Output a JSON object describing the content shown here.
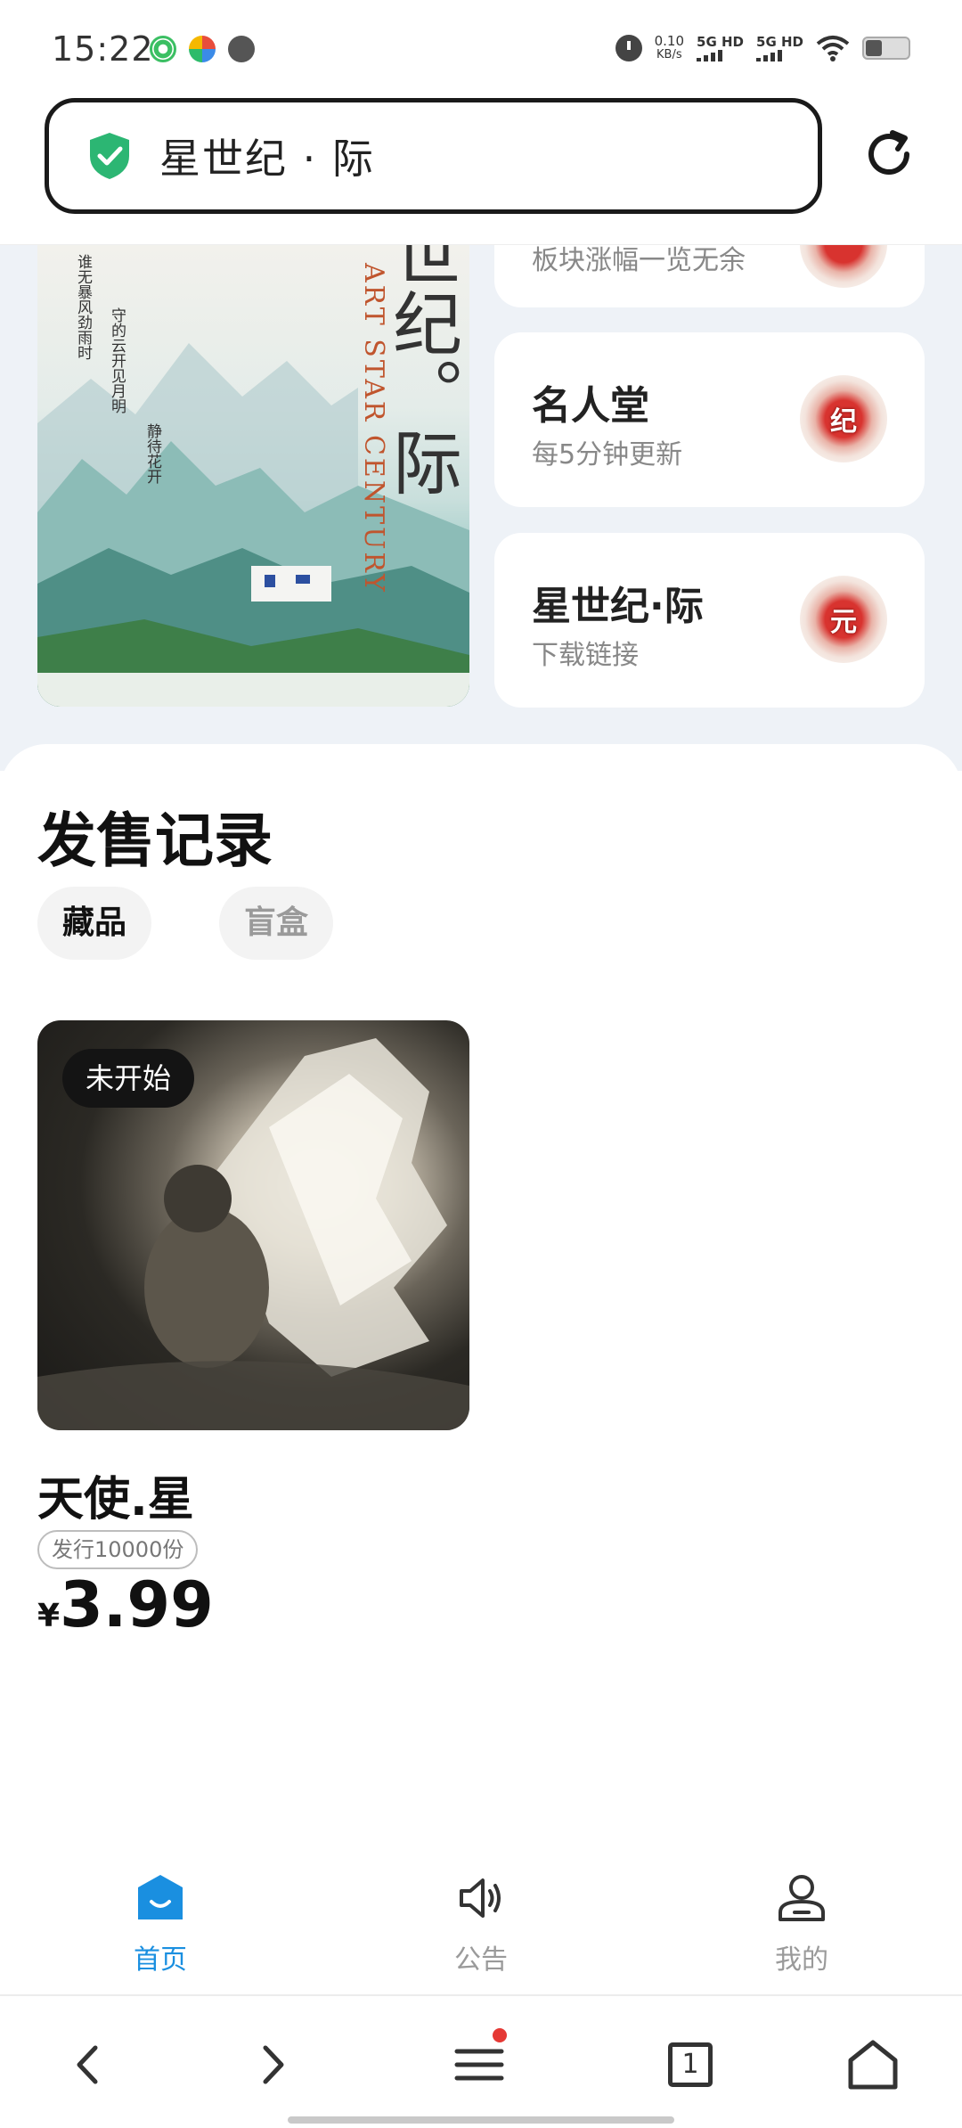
{
  "status_bar": {
    "time": "15:22",
    "net_speed_value": "0.10",
    "net_speed_unit": "KB/s",
    "sim1": "5G HD",
    "sim2": "5G HD",
    "icons": [
      "app-icon-green",
      "app-icon-colorful",
      "alarm-icon",
      "alarm-icon",
      "signal-icon",
      "signal-icon",
      "wifi-icon",
      "battery-icon"
    ]
  },
  "url_bar": {
    "title": "星世纪 · 际",
    "secure_icon": "shield-check-icon",
    "reload_icon": "reload-icon"
  },
  "poster": {
    "title": "世纪。际",
    "subtitle_en": "ART STAR CENTURY",
    "poem_1": "谁无暴风劲雨时",
    "poem_2": "守的云开见月明",
    "poem_3": "静待花开"
  },
  "cards": [
    {
      "title": "",
      "subtitle": "板块涨幅一览无余",
      "badge": ""
    },
    {
      "title": "名人堂",
      "subtitle": "每5分钟更新",
      "badge": "纪"
    },
    {
      "title": "星世纪·际",
      "subtitle": "下载链接",
      "badge": "元"
    }
  ],
  "sales": {
    "title": "发售记录",
    "tabs": [
      {
        "label": "藏品",
        "active": true
      },
      {
        "label": "盲盒",
        "active": false
      }
    ],
    "item": {
      "status": "未开始",
      "name": "天使.星",
      "edition": "发行10000份",
      "currency": "¥",
      "price": "3.99"
    }
  },
  "tab_bar": {
    "items": [
      {
        "label": "首页",
        "icon": "home-icon",
        "active": true
      },
      {
        "label": "公告",
        "icon": "speaker-icon",
        "active": false
      },
      {
        "label": "我的",
        "icon": "user-icon",
        "active": false
      }
    ],
    "active_color": "#1a8fe0",
    "inactive_color": "#9a9a9a"
  },
  "browser_nav": {
    "tab_count": "1",
    "icons": [
      "back-icon",
      "forward-icon",
      "menu-icon",
      "tabs-icon",
      "home-icon"
    ],
    "notification_dot_color": "#e53935"
  }
}
